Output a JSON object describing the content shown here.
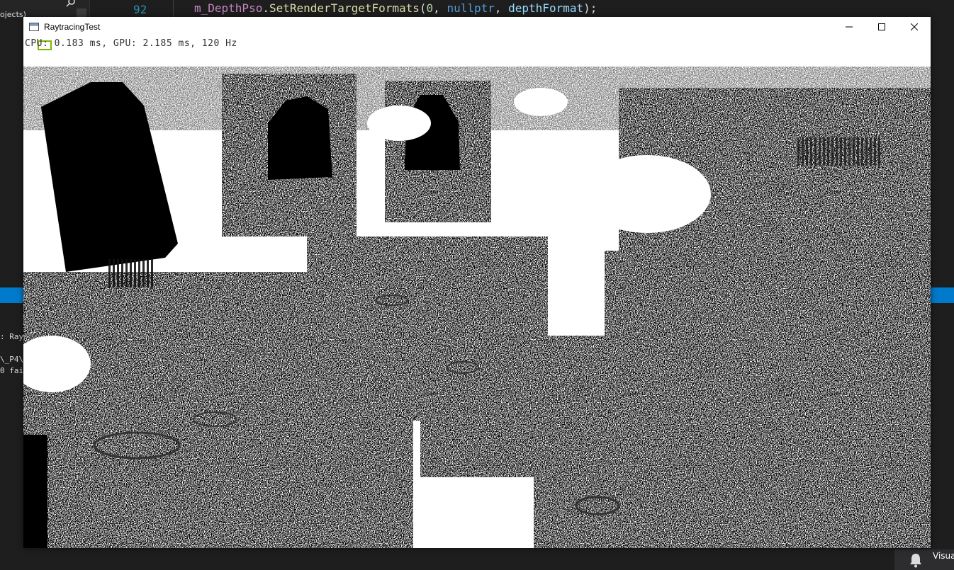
{
  "ide": {
    "left_label": "ojects)",
    "line_number": "92",
    "code": {
      "object": "m_DepthPso",
      "dot": ".",
      "method": "SetRenderTargetFormats",
      "open": "(",
      "arg1": "0",
      "comma1": ", ",
      "arg2": "nullptr",
      "comma2": ", ",
      "arg3": "depthFormat",
      "close": ");"
    },
    "output_lines": ": Ray\n\n\\_P4\\\n0 fai",
    "status_label": "Visua",
    "accent_color": "#007acc"
  },
  "window": {
    "title": "RaytracingTest",
    "minimize_icon": "minimize-icon",
    "maximize_icon": "maximize-icon",
    "close_icon": "close-icon"
  },
  "viewport": {
    "perf_text": "CPU: 0.183 ms, GPU: 2.185 ms, 120 Hz",
    "scene_description_icon": "raytraced-render-image"
  }
}
